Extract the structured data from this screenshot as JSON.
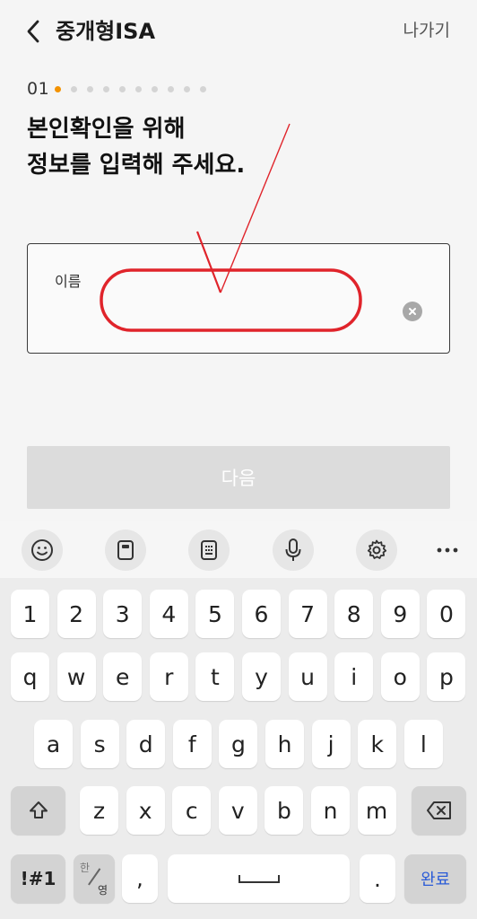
{
  "header": {
    "title": "중개형ISA",
    "exit_label": "나가기"
  },
  "progress": {
    "step_label": "01",
    "current_step": 1,
    "total_steps": 10,
    "active_color": "#f39200"
  },
  "heading": {
    "line1": "본인확인을 위해",
    "line2": "정보를 입력해 주세요."
  },
  "name_field": {
    "label": "이름",
    "value": ""
  },
  "next_button": {
    "label": "다음"
  },
  "keyboard": {
    "toolbar": [
      "emoji-icon",
      "clipboard-icon",
      "keypad-icon",
      "microphone-icon",
      "settings-icon",
      "more-icon"
    ],
    "row_numbers": [
      "1",
      "2",
      "3",
      "4",
      "5",
      "6",
      "7",
      "8",
      "9",
      "0"
    ],
    "row1": [
      "q",
      "w",
      "e",
      "r",
      "t",
      "y",
      "u",
      "i",
      "o",
      "p"
    ],
    "row2": [
      "a",
      "s",
      "d",
      "f",
      "g",
      "h",
      "j",
      "k",
      "l"
    ],
    "row3": [
      "z",
      "x",
      "c",
      "v",
      "b",
      "n",
      "m"
    ],
    "symbols_label": "!#1",
    "lang_top": "한",
    "lang_bottom": "영",
    "comma": ",",
    "period": ".",
    "done_label": "완료"
  },
  "annotation": {
    "color": "#e0242b"
  }
}
